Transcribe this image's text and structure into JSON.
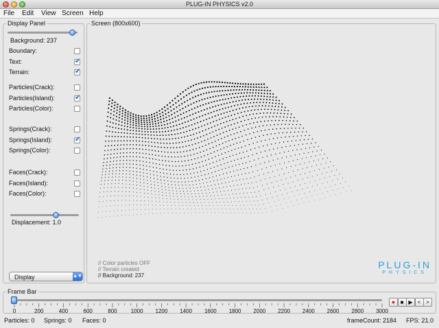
{
  "window": {
    "title": "PLUG-IN PHYSICS v2.0"
  },
  "menu": [
    "File",
    "Edit",
    "View",
    "Screen",
    "Help"
  ],
  "display_panel": {
    "title": "Display Panel",
    "background_label": "Background: 237",
    "background_level": 237,
    "checkbox_groups": [
      [
        {
          "label": "Boundary:",
          "checked": false
        },
        {
          "label": "Text:",
          "checked": true
        },
        {
          "label": "Terrain:",
          "checked": true
        }
      ],
      [
        {
          "label": "Particles(Crack):",
          "checked": false
        },
        {
          "label": "Particles(Island):",
          "checked": true
        },
        {
          "label": "Particles(Color):",
          "checked": false
        }
      ],
      [
        {
          "label": "Springs(Crack):",
          "checked": false
        },
        {
          "label": "Springs(Island):",
          "checked": true
        },
        {
          "label": "Springs(Color):",
          "checked": false
        }
      ],
      [
        {
          "label": "Faces(Crack):",
          "checked": false
        },
        {
          "label": "Faces(Island):",
          "checked": false
        },
        {
          "label": "Faces(Color):",
          "checked": false
        }
      ]
    ],
    "displacement_label": "Displacement: 1.0",
    "displacement_fraction": 0.67,
    "mode_select": "Display"
  },
  "screen_panel": {
    "title": "Screen (800x600)",
    "log": [
      "// Color particles OFF",
      "// Terrain created",
      "// Background: 237"
    ],
    "brand_main": "PLUG-IN",
    "brand_sub": "PHYSICS"
  },
  "frame_bar": {
    "title": "Frame Bar",
    "ticks": [
      "0",
      "200",
      "400",
      "600",
      "800",
      "1000",
      "1200",
      "1400",
      "1600",
      "1800",
      "2000",
      "2200",
      "2400",
      "2600",
      "2800",
      "3000"
    ],
    "current_frame": 0,
    "transport": [
      {
        "name": "record-button",
        "glyph": "●"
      },
      {
        "name": "stop-button",
        "glyph": "■"
      },
      {
        "name": "play-button",
        "glyph": "▶"
      },
      {
        "name": "step-back-button",
        "glyph": "<"
      },
      {
        "name": "step-forward-button",
        "glyph": ">"
      }
    ]
  },
  "status": {
    "particles": "Particles: 0",
    "springs": "Springs: 0",
    "faces": "Faces: 0",
    "frame_count": "frameCount: 2184",
    "fps": "FPS: 21.0"
  },
  "colors": {
    "brand": "#2a9fd6",
    "knob": "#3a7fd6",
    "record": "#e02020"
  }
}
